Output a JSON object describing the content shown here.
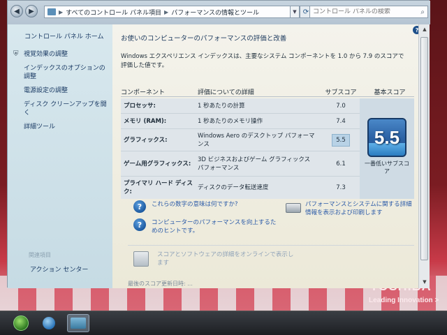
{
  "address": {
    "breadcrumb": [
      "すべてのコントロール パネル項目",
      "パフォーマンスの情報とツール"
    ],
    "search_placeholder": "コントロール パネルの検索"
  },
  "left_pane": {
    "home": "コントロール パネル ホーム",
    "tasks": [
      {
        "label": "視覚効果の調整",
        "icon": "shield-icon"
      },
      {
        "label": "インデックスのオプションの調整",
        "icon": ""
      },
      {
        "label": "電源設定の調整",
        "icon": ""
      },
      {
        "label": "ディスク クリーンアップを開く",
        "icon": ""
      },
      {
        "label": "詳細ツール",
        "icon": ""
      }
    ],
    "see_also": "関連項目",
    "action_center": "アクション センター"
  },
  "main": {
    "heading": "お使いのコンピューターのパフォーマンスの評価と改善",
    "intro": "Windows エクスペリエンス インデックスは、主要なシステム コンポーネントを 1.0 から 7.9 のスコアで評価した値です。",
    "columns": {
      "component": "コンポーネント",
      "details": "評価についての詳細",
      "subscore": "サブスコア",
      "base": "基本スコア"
    },
    "rows": [
      {
        "component": "プロセッサ:",
        "detail": "1 秒あたりの計算",
        "score": "7.0"
      },
      {
        "component": "メモリ (RAM):",
        "detail": "1 秒あたりのメモリ操作",
        "score": "7.4"
      },
      {
        "component": "グラフィックス:",
        "detail": "Windows Aero のデスクトップ パフォーマンス",
        "score": "5.5"
      },
      {
        "component": "ゲーム用グラフィックス:",
        "detail": "3D ビジネスおよびゲーム グラフィックス パフォーマンス",
        "score": "6.1"
      },
      {
        "component": "プライマリ ハード ディスク:",
        "detail": "ディスクのデータ転送速度",
        "score": "7.3"
      }
    ],
    "base_score": "5.5",
    "base_caption": "一番低いサブスコア",
    "links": {
      "meaning": "これらの数字の意味は何ですか?",
      "tips": "コンピューターのパフォーマンスを向上するためのヒントです。",
      "print": "パフォーマンスとシステムに関する詳細情報を表示および印刷します",
      "online": "スコアとソフトウェアの詳細をオンラインで表示します",
      "cut": "最後のスコア更新日時: ..."
    }
  },
  "desktop": {
    "brand": "TOSHIBA",
    "tagline": "Leading Innovation >"
  }
}
